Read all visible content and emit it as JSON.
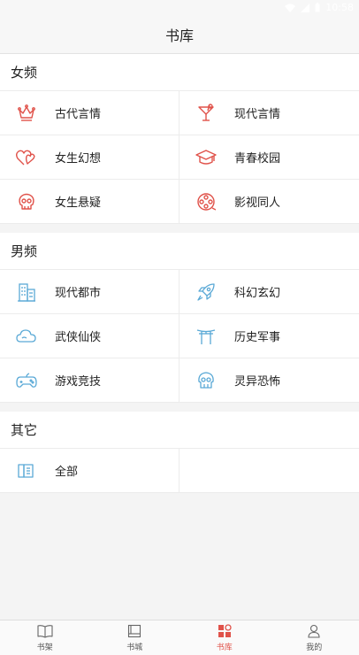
{
  "status": {
    "time": "10:58"
  },
  "header": {
    "title": "书库"
  },
  "sections": [
    {
      "title": "女频",
      "items": [
        {
          "label": "古代言情",
          "icon": "crown-icon"
        },
        {
          "label": "现代言情",
          "icon": "cocktail-icon"
        },
        {
          "label": "女生幻想",
          "icon": "hearts-icon"
        },
        {
          "label": "青春校园",
          "icon": "graduation-cap-icon"
        },
        {
          "label": "女生悬疑",
          "icon": "skull-icon"
        },
        {
          "label": "影视同人",
          "icon": "film-reel-icon"
        }
      ]
    },
    {
      "title": "男频",
      "items": [
        {
          "label": "现代都市",
          "icon": "city-buildings-icon"
        },
        {
          "label": "科幻玄幻",
          "icon": "rocket-icon"
        },
        {
          "label": "武侠仙侠",
          "icon": "cloud-icon"
        },
        {
          "label": "历史军事",
          "icon": "gate-icon"
        },
        {
          "label": "游戏竞技",
          "icon": "gamepad-icon"
        },
        {
          "label": "灵异恐怖",
          "icon": "ghost-skull-icon"
        }
      ]
    },
    {
      "title": "其它",
      "items": [
        {
          "label": "全部",
          "icon": "books-icon"
        }
      ]
    }
  ],
  "tabs": [
    {
      "label": "书架",
      "icon": "open-book-icon"
    },
    {
      "label": "书城",
      "icon": "bookstore-icon"
    },
    {
      "label": "书库",
      "icon": "library-grid-icon",
      "active": true
    },
    {
      "label": "我的",
      "icon": "person-icon"
    }
  ],
  "colors": {
    "female_icon": "#e0524a",
    "male_icon": "#5aa9d6",
    "active_tab": "#e0524a"
  }
}
